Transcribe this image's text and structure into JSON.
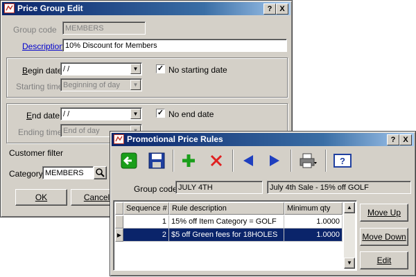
{
  "price_group_edit": {
    "title": "Price Group Edit",
    "help_btn": "?",
    "close_btn": "X",
    "group_code_label": "Group code",
    "group_code_value": "MEMBERS",
    "description_label": "Description",
    "description_value": "10% Discount for Members",
    "begin_date_label": "Begin date",
    "begin_date_value": " /  /",
    "no_starting_date_label": "No starting date",
    "no_starting_date_checked": "✓",
    "starting_time_label": "Starting time",
    "starting_time_value": "Beginning of day",
    "end_date_label": "End date",
    "end_date_value": " /  /",
    "no_end_date_label": "No end date",
    "no_end_date_checked": "✓",
    "ending_time_label": "Ending time",
    "ending_time_value": "End of day",
    "customer_filter_label": "Customer filter",
    "category_label": "Category",
    "category_value": "MEMBERS",
    "ok_button": "OK",
    "cancel_button": "Cancel"
  },
  "promo_rules": {
    "title": "Promotional Price Rules",
    "help_btn": "?",
    "close_btn": "X",
    "group_code_label": "Group code",
    "group_code_value": "JULY 4TH",
    "group_description": "July 4th Sale - 15% off GOLF",
    "columns": [
      "Sequence #",
      "Rule description",
      "Minimum qty"
    ],
    "rows": [
      {
        "seq": "1",
        "desc": "15% off Item Category = GOLF",
        "min_qty": "1.0000"
      },
      {
        "seq": "2",
        "desc": "$5 off Green fees for 18HOLES",
        "min_qty": "1.0000"
      }
    ],
    "selected_row": "2",
    "move_up_button": "Move Up",
    "move_down_button": "Move Down",
    "edit_button": "Edit",
    "toolbar": [
      "back",
      "save",
      "add",
      "delete",
      "previous",
      "next",
      "print",
      "help"
    ]
  },
  "colors": {
    "title_active": "#0a246a",
    "title_gradient_end": "#a6caf0",
    "window_face": "#d4d0c8",
    "selection": "#0a246a",
    "link": "#0000cc",
    "add_green": "#1a9e1a",
    "delete_red": "#e02020",
    "nav_blue": "#1f3fbf"
  }
}
